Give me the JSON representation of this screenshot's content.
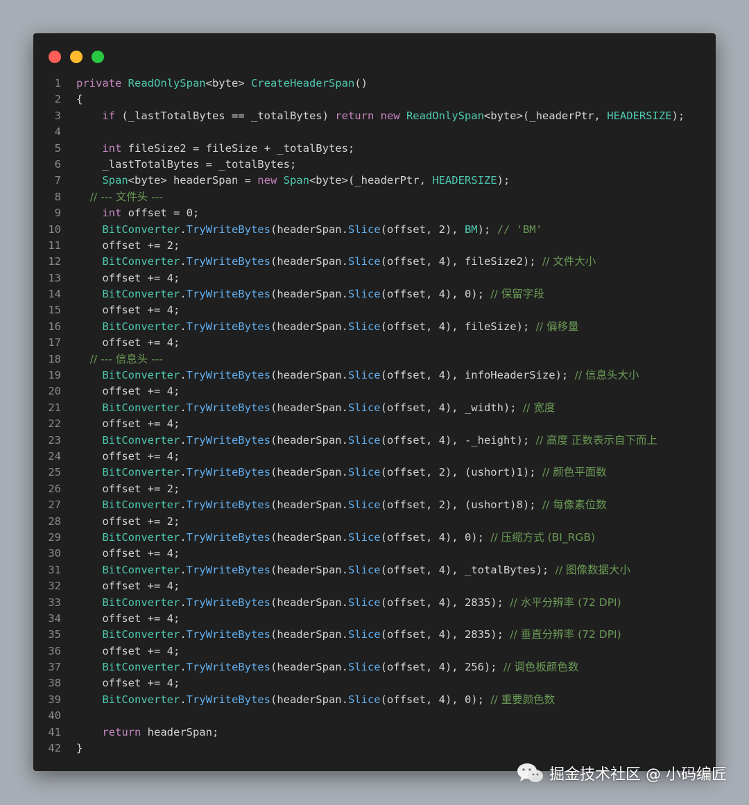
{
  "window": {
    "controls": [
      "close",
      "minimize",
      "maximize"
    ],
    "colors": {
      "close": "#ff5f57",
      "minimize": "#febc2e",
      "maximize": "#28c840"
    }
  },
  "code_lines": [
    [
      {
        "t": "private ",
        "c": "t-kw"
      },
      {
        "t": "ReadOnlySpan",
        "c": "t-type"
      },
      {
        "t": "<byte> ",
        "c": "t-plain"
      },
      {
        "t": "CreateHeaderSpan",
        "c": "t-fn"
      },
      {
        "t": "()",
        "c": "t-plain"
      }
    ],
    [
      {
        "t": "{",
        "c": "t-plain"
      }
    ],
    [
      {
        "t": "    if ",
        "c": "t-kw"
      },
      {
        "t": "(_lastTotalBytes == _totalBytes) ",
        "c": "t-plain"
      },
      {
        "t": "return ",
        "c": "t-kw"
      },
      {
        "t": "new ",
        "c": "t-new"
      },
      {
        "t": "ReadOnlySpan",
        "c": "t-type"
      },
      {
        "t": "<byte>(_headerPtr, ",
        "c": "t-plain"
      },
      {
        "t": "HEADERSIZE",
        "c": "t-const"
      },
      {
        "t": ");",
        "c": "t-plain"
      }
    ],
    [],
    [
      {
        "t": "    int ",
        "c": "t-kw"
      },
      {
        "t": "fileSize2 = fileSize + _totalBytes;",
        "c": "t-plain"
      }
    ],
    [
      {
        "t": "    _lastTotalBytes = _totalBytes;",
        "c": "t-plain"
      }
    ],
    [
      {
        "t": "    Span",
        "c": "t-type"
      },
      {
        "t": "<byte> headerSpan = ",
        "c": "t-plain"
      },
      {
        "t": "new ",
        "c": "t-new"
      },
      {
        "t": "Span",
        "c": "t-type"
      },
      {
        "t": "<byte>(_headerPtr, ",
        "c": "t-plain"
      },
      {
        "t": "HEADERSIZE",
        "c": "t-const"
      },
      {
        "t": ");",
        "c": "t-plain"
      }
    ],
    [
      {
        "t": "    // --- 文件头 ---",
        "c": "t-cm"
      }
    ],
    [
      {
        "t": "    int ",
        "c": "t-kw"
      },
      {
        "t": "offset = 0;",
        "c": "t-plain"
      }
    ],
    [
      {
        "t": "    BitConverter",
        "c": "t-cls"
      },
      {
        "t": ".",
        "c": "t-plain"
      },
      {
        "t": "TryWriteBytes",
        "c": "t-m"
      },
      {
        "t": "(headerSpan.",
        "c": "t-plain"
      },
      {
        "t": "Slice",
        "c": "t-m"
      },
      {
        "t": "(offset, 2), ",
        "c": "t-plain"
      },
      {
        "t": "BM",
        "c": "t-const"
      },
      {
        "t": "); ",
        "c": "t-plain"
      },
      {
        "t": "// 'BM'",
        "c": "t-cm"
      }
    ],
    [
      {
        "t": "    offset += 2;",
        "c": "t-plain"
      }
    ],
    [
      {
        "t": "    BitConverter",
        "c": "t-cls"
      },
      {
        "t": ".",
        "c": "t-plain"
      },
      {
        "t": "TryWriteBytes",
        "c": "t-m"
      },
      {
        "t": "(headerSpan.",
        "c": "t-plain"
      },
      {
        "t": "Slice",
        "c": "t-m"
      },
      {
        "t": "(offset, 4), fileSize2); ",
        "c": "t-plain"
      },
      {
        "t": "// 文件大小",
        "c": "t-cm"
      }
    ],
    [
      {
        "t": "    offset += 4;",
        "c": "t-plain"
      }
    ],
    [
      {
        "t": "    BitConverter",
        "c": "t-cls"
      },
      {
        "t": ".",
        "c": "t-plain"
      },
      {
        "t": "TryWriteBytes",
        "c": "t-m"
      },
      {
        "t": "(headerSpan.",
        "c": "t-plain"
      },
      {
        "t": "Slice",
        "c": "t-m"
      },
      {
        "t": "(offset, 4), 0); ",
        "c": "t-plain"
      },
      {
        "t": "// 保留字段",
        "c": "t-cm"
      }
    ],
    [
      {
        "t": "    offset += 4;",
        "c": "t-plain"
      }
    ],
    [
      {
        "t": "    BitConverter",
        "c": "t-cls"
      },
      {
        "t": ".",
        "c": "t-plain"
      },
      {
        "t": "TryWriteBytes",
        "c": "t-m"
      },
      {
        "t": "(headerSpan.",
        "c": "t-plain"
      },
      {
        "t": "Slice",
        "c": "t-m"
      },
      {
        "t": "(offset, 4), fileSize); ",
        "c": "t-plain"
      },
      {
        "t": "// 偏移量",
        "c": "t-cm"
      }
    ],
    [
      {
        "t": "    offset += 4;",
        "c": "t-plain"
      }
    ],
    [
      {
        "t": "    // --- 信息头 ---",
        "c": "t-cm"
      }
    ],
    [
      {
        "t": "    BitConverter",
        "c": "t-cls"
      },
      {
        "t": ".",
        "c": "t-plain"
      },
      {
        "t": "TryWriteBytes",
        "c": "t-m"
      },
      {
        "t": "(headerSpan.",
        "c": "t-plain"
      },
      {
        "t": "Slice",
        "c": "t-m"
      },
      {
        "t": "(offset, 4), infoHeaderSize); ",
        "c": "t-plain"
      },
      {
        "t": "// 信息头大小",
        "c": "t-cm"
      }
    ],
    [
      {
        "t": "    offset += 4;",
        "c": "t-plain"
      }
    ],
    [
      {
        "t": "    BitConverter",
        "c": "t-cls"
      },
      {
        "t": ".",
        "c": "t-plain"
      },
      {
        "t": "TryWriteBytes",
        "c": "t-m"
      },
      {
        "t": "(headerSpan.",
        "c": "t-plain"
      },
      {
        "t": "Slice",
        "c": "t-m"
      },
      {
        "t": "(offset, 4), _width); ",
        "c": "t-plain"
      },
      {
        "t": "// 宽度",
        "c": "t-cm"
      }
    ],
    [
      {
        "t": "    offset += 4;",
        "c": "t-plain"
      }
    ],
    [
      {
        "t": "    BitConverter",
        "c": "t-cls"
      },
      {
        "t": ".",
        "c": "t-plain"
      },
      {
        "t": "TryWriteBytes",
        "c": "t-m"
      },
      {
        "t": "(headerSpan.",
        "c": "t-plain"
      },
      {
        "t": "Slice",
        "c": "t-m"
      },
      {
        "t": "(offset, 4), -_height); ",
        "c": "t-plain"
      },
      {
        "t": "// 高度 正数表示自下而上",
        "c": "t-cm"
      }
    ],
    [
      {
        "t": "    offset += 4;",
        "c": "t-plain"
      }
    ],
    [
      {
        "t": "    BitConverter",
        "c": "t-cls"
      },
      {
        "t": ".",
        "c": "t-plain"
      },
      {
        "t": "TryWriteBytes",
        "c": "t-m"
      },
      {
        "t": "(headerSpan.",
        "c": "t-plain"
      },
      {
        "t": "Slice",
        "c": "t-m"
      },
      {
        "t": "(offset, 2), (ushort)1); ",
        "c": "t-plain"
      },
      {
        "t": "// 颜色平面数",
        "c": "t-cm"
      }
    ],
    [
      {
        "t": "    offset += 2;",
        "c": "t-plain"
      }
    ],
    [
      {
        "t": "    BitConverter",
        "c": "t-cls"
      },
      {
        "t": ".",
        "c": "t-plain"
      },
      {
        "t": "TryWriteBytes",
        "c": "t-m"
      },
      {
        "t": "(headerSpan.",
        "c": "t-plain"
      },
      {
        "t": "Slice",
        "c": "t-m"
      },
      {
        "t": "(offset, 2), (ushort)8); ",
        "c": "t-plain"
      },
      {
        "t": "// 每像素位数",
        "c": "t-cm"
      }
    ],
    [
      {
        "t": "    offset += 2;",
        "c": "t-plain"
      }
    ],
    [
      {
        "t": "    BitConverter",
        "c": "t-cls"
      },
      {
        "t": ".",
        "c": "t-plain"
      },
      {
        "t": "TryWriteBytes",
        "c": "t-m"
      },
      {
        "t": "(headerSpan.",
        "c": "t-plain"
      },
      {
        "t": "Slice",
        "c": "t-m"
      },
      {
        "t": "(offset, 4), 0); ",
        "c": "t-plain"
      },
      {
        "t": "// 压缩方式 (BI_RGB)",
        "c": "t-cm"
      }
    ],
    [
      {
        "t": "    offset += 4;",
        "c": "t-plain"
      }
    ],
    [
      {
        "t": "    BitConverter",
        "c": "t-cls"
      },
      {
        "t": ".",
        "c": "t-plain"
      },
      {
        "t": "TryWriteBytes",
        "c": "t-m"
      },
      {
        "t": "(headerSpan.",
        "c": "t-plain"
      },
      {
        "t": "Slice",
        "c": "t-m"
      },
      {
        "t": "(offset, 4), _totalBytes); ",
        "c": "t-plain"
      },
      {
        "t": "// 图像数据大小",
        "c": "t-cm"
      }
    ],
    [
      {
        "t": "    offset += 4;",
        "c": "t-plain"
      }
    ],
    [
      {
        "t": "    BitConverter",
        "c": "t-cls"
      },
      {
        "t": ".",
        "c": "t-plain"
      },
      {
        "t": "TryWriteBytes",
        "c": "t-m"
      },
      {
        "t": "(headerSpan.",
        "c": "t-plain"
      },
      {
        "t": "Slice",
        "c": "t-m"
      },
      {
        "t": "(offset, 4), 2835); ",
        "c": "t-plain"
      },
      {
        "t": "// 水平分辨率 (72 DPI)",
        "c": "t-cm"
      }
    ],
    [
      {
        "t": "    offset += 4;",
        "c": "t-plain"
      }
    ],
    [
      {
        "t": "    BitConverter",
        "c": "t-cls"
      },
      {
        "t": ".",
        "c": "t-plain"
      },
      {
        "t": "TryWriteBytes",
        "c": "t-m"
      },
      {
        "t": "(headerSpan.",
        "c": "t-plain"
      },
      {
        "t": "Slice",
        "c": "t-m"
      },
      {
        "t": "(offset, 4), 2835); ",
        "c": "t-plain"
      },
      {
        "t": "// 垂直分辨率 (72 DPI)",
        "c": "t-cm"
      }
    ],
    [
      {
        "t": "    offset += 4;",
        "c": "t-plain"
      }
    ],
    [
      {
        "t": "    BitConverter",
        "c": "t-cls"
      },
      {
        "t": ".",
        "c": "t-plain"
      },
      {
        "t": "TryWriteBytes",
        "c": "t-m"
      },
      {
        "t": "(headerSpan.",
        "c": "t-plain"
      },
      {
        "t": "Slice",
        "c": "t-m"
      },
      {
        "t": "(offset, 4), 256); ",
        "c": "t-plain"
      },
      {
        "t": "// 调色板颜色数",
        "c": "t-cm"
      }
    ],
    [
      {
        "t": "    offset += 4;",
        "c": "t-plain"
      }
    ],
    [
      {
        "t": "    BitConverter",
        "c": "t-cls"
      },
      {
        "t": ".",
        "c": "t-plain"
      },
      {
        "t": "TryWriteBytes",
        "c": "t-m"
      },
      {
        "t": "(headerSpan.",
        "c": "t-plain"
      },
      {
        "t": "Slice",
        "c": "t-m"
      },
      {
        "t": "(offset, 4), 0); ",
        "c": "t-plain"
      },
      {
        "t": "// 重要颜色数",
        "c": "t-cm"
      }
    ],
    [],
    [
      {
        "t": "    return ",
        "c": "t-kw"
      },
      {
        "t": "headerSpan;",
        "c": "t-plain"
      }
    ],
    [
      {
        "t": "}",
        "c": "t-plain"
      }
    ]
  ],
  "watermark": {
    "icon": "wechat-icon",
    "text": "掘金技术社区 @ 小码编匠"
  }
}
